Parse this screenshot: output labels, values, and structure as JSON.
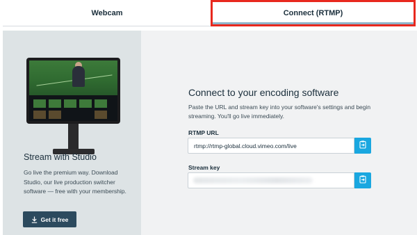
{
  "tabs": [
    {
      "label": "Webcam"
    },
    {
      "label": "Connect (RTMP)"
    }
  ],
  "studio_promo": {
    "title": "Stream with Studio",
    "description": "Go live the premium way. Download Studio, our live production switcher software — free with your membership.",
    "button_label": "Get it free",
    "button_icon": "download-icon"
  },
  "encoder": {
    "heading": "Connect to your encoding software",
    "description": "Paste the URL and stream key into your software's settings and begin streaming. You'll go live immediately.",
    "rtmp_url_label": "RTMP URL",
    "rtmp_url_value": "rtmp://rtmp-global.cloud.vimeo.com/live",
    "stream_key_label": "Stream key",
    "stream_key_value": "",
    "copy_icon": "copy-icon"
  },
  "colors": {
    "accent": "#1aa7e0",
    "button_dark": "#2c4a5e",
    "highlight_border": "#e8281e",
    "left_panel_bg": "#dde3e5",
    "right_panel_bg": "#f1f2f3"
  }
}
